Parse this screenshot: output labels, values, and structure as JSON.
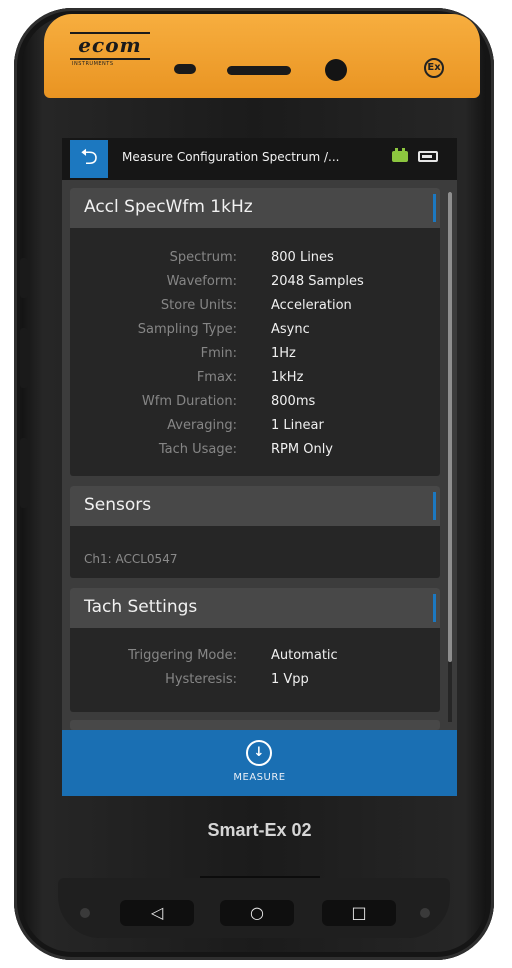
{
  "device": {
    "brand": "ecom",
    "brand_sub": "INSTRUMENTS",
    "model": "Smart-Ex 02",
    "ex_mark": "Ex"
  },
  "app_bar": {
    "back_icon": "back-arrow-icon",
    "title": "Measure Configuration Spectrum /...",
    "status_icons": [
      "battery-icon",
      "sd-card-icon"
    ],
    "battery_color": "#8cc63f"
  },
  "config_panel": {
    "title": "Accl SpecWfm 1kHz",
    "rows": [
      {
        "label": "Spectrum:",
        "value": "800 Lines"
      },
      {
        "label": "Waveform:",
        "value": "2048 Samples"
      },
      {
        "label": "Store Units:",
        "value": "Acceleration"
      },
      {
        "label": "Sampling Type:",
        "value": "Async"
      },
      {
        "label": "Fmin:",
        "value": "1Hz"
      },
      {
        "label": "Fmax:",
        "value": "1kHz"
      },
      {
        "label": "Wfm Duration:",
        "value": "800ms"
      },
      {
        "label": "Averaging:",
        "value": "1 Linear"
      },
      {
        "label": "Tach Usage:",
        "value": "RPM Only"
      }
    ]
  },
  "sensors_panel": {
    "title": "Sensors",
    "line": "Ch1: ACCL0547"
  },
  "tach_panel": {
    "title": "Tach Settings",
    "rows": [
      {
        "label": "Triggering Mode:",
        "value": "Automatic"
      },
      {
        "label": "Hysteresis:",
        "value": "1 Vpp"
      }
    ]
  },
  "measure_button": {
    "icon": "measure-icon",
    "label": "MEASURE"
  },
  "nav": {
    "back": "◁",
    "home": "○",
    "recents": "□"
  },
  "colors": {
    "accent": "#1c78c0",
    "measure_bar": "#1a6fb3",
    "top_housing": "#f2a233"
  }
}
